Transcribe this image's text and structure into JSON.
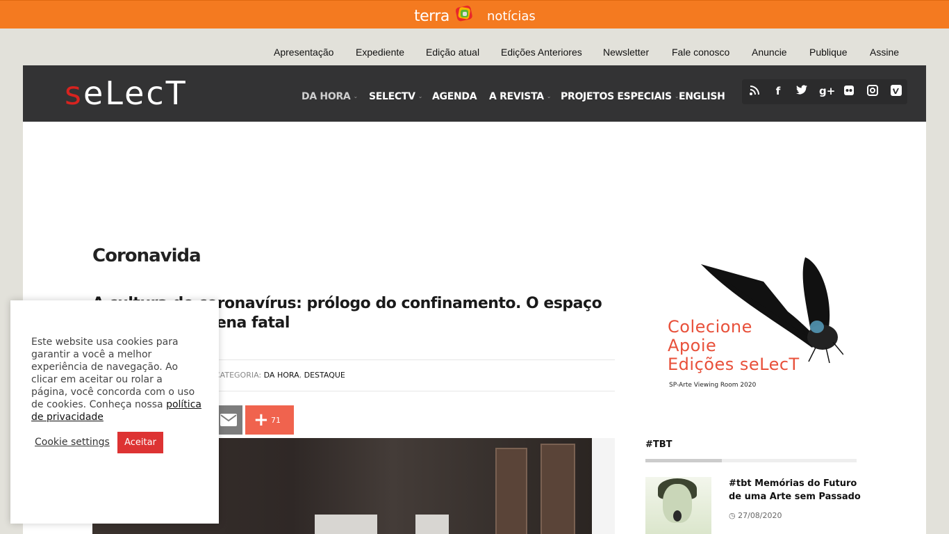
{
  "terra": {
    "brand": "terra",
    "section": "notícias",
    "bar_color": "#f47a20"
  },
  "top_links": [
    "Apresentação",
    "Expediente",
    "Edição atual",
    "Edições Anteriores",
    "Newsletter",
    "Fale conosco",
    "Anuncie",
    "Publique",
    "Assine"
  ],
  "header": {
    "logo_red": "s",
    "logo_rest": "eLecT",
    "nav": [
      {
        "label": "DA HORA",
        "dropdown": true
      },
      {
        "label": "SELECTV",
        "dropdown": true
      },
      {
        "label": "AGENDA",
        "dropdown": false
      },
      {
        "label": "A REVISTA",
        "dropdown": true
      },
      {
        "label": "PROJETOS ESPECIAIS",
        "dropdown": true
      },
      {
        "label": "ENGLISH",
        "dropdown": false
      }
    ],
    "social_icons": [
      "rss-icon",
      "facebook-icon",
      "twitter-icon",
      "google-plus-icon",
      "flickr-icon",
      "instagram-icon",
      "vimeo-icon"
    ]
  },
  "main": {
    "section_title": "Coronavida",
    "article_title": "A cultura do coronavírus: prólogo do confinamento. O espaço público como cena fatal",
    "category_label": "CATEGORIA:",
    "categories": [
      "DA HORA",
      "DESTAQUE"
    ],
    "share_count": "71"
  },
  "sidebar": {
    "ad_lines": [
      "Colecione",
      "Apoie",
      "Edições seLecT"
    ],
    "ad_caption": "SP-Arte Viewing Room 2020",
    "tbt_heading": "#TBT",
    "tbt_post_title": "#tbt Memórias do Futuro de uma Arte sem Passado",
    "tbt_post_date": "27/08/2020"
  },
  "cookie": {
    "text": "Este website usa cookies para garantir a você a melhor experiência de navegação. Ao clicar em aceitar ou rolar a página, você concorda com o uso de cookies. Conheça nossa ",
    "link": "política de privacidade",
    "settings_label": "Cookie settings",
    "accept_label": "Aceitar"
  }
}
